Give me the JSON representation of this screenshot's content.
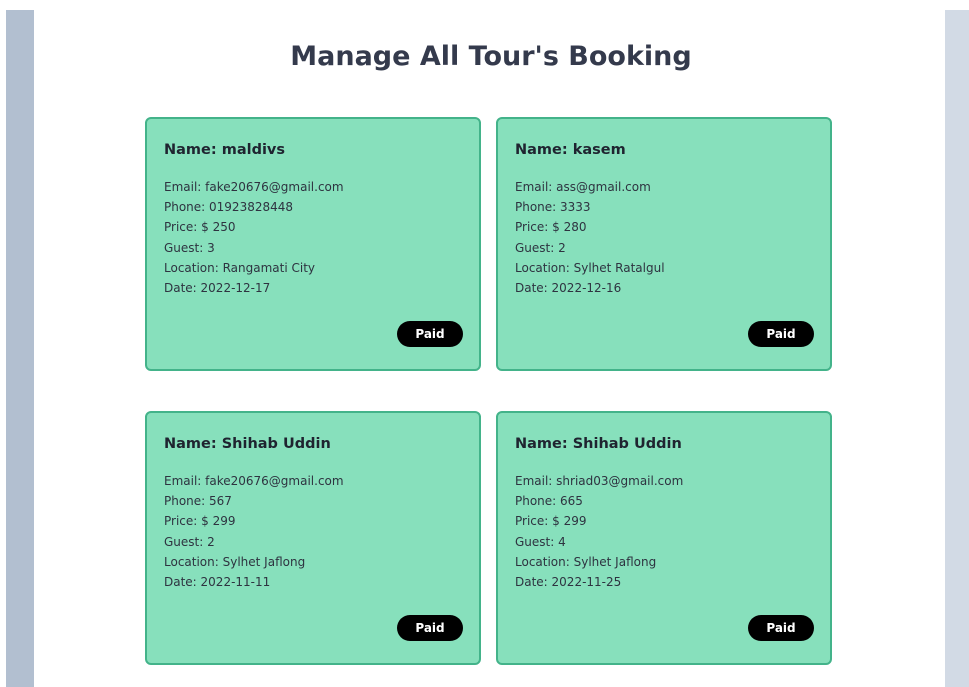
{
  "page_title": "Manage All Tour's Booking",
  "bookings": [
    {
      "name": "Name: maldivs",
      "email": "Email: fake20676@gmail.com",
      "phone": "Phone: 01923828448",
      "price": "Price: $ 250",
      "guest": "Guest: 3",
      "location": "Location: Rangamati City",
      "date": "Date: 2022-12-17",
      "status": "Paid"
    },
    {
      "name": "Name: kasem",
      "email": "Email: ass@gmail.com",
      "phone": "Phone: 3333",
      "price": "Price: $ 280",
      "guest": "Guest: 2",
      "location": "Location: Sylhet Ratalgul",
      "date": "Date: 2022-12-16",
      "status": "Paid"
    },
    {
      "name": "Name: Shihab Uddin",
      "email": "Email: fake20676@gmail.com",
      "phone": "Phone: 567",
      "price": "Price: $ 299",
      "guest": "Guest: 2",
      "location": "Location: Sylhet Jaflong",
      "date": "Date: 2022-11-11",
      "status": "Paid"
    },
    {
      "name": "Name: Shihab Uddin",
      "email": "Email: shriad03@gmail.com",
      "phone": "Phone: 665",
      "price": "Price: $ 299",
      "guest": "Guest: 4",
      "location": "Location: Sylhet Jaflong",
      "date": "Date: 2022-11-25",
      "status": "Paid"
    }
  ],
  "colors": {
    "card_background": "#87e0bc",
    "card_border": "#43b38a",
    "badge_background": "#000000",
    "badge_text": "#ffffff",
    "title": "#343a4c"
  }
}
